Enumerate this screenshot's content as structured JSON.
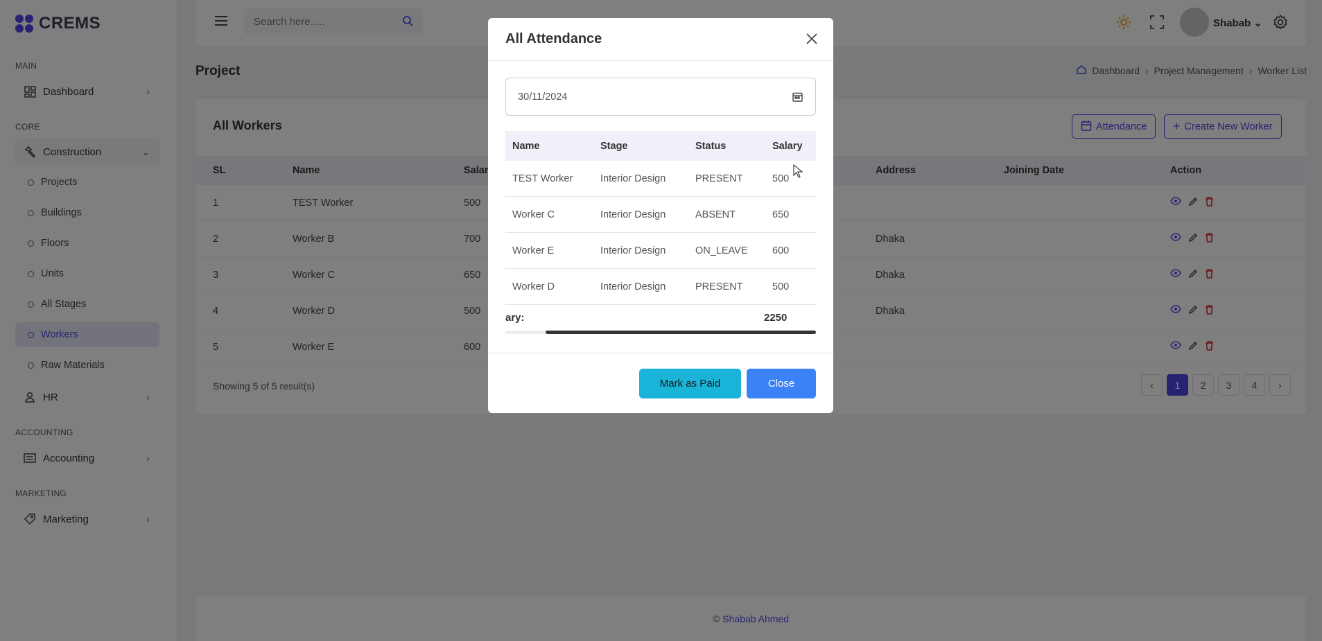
{
  "app": {
    "name": "CREMS"
  },
  "sidebar": {
    "sections": {
      "main": "MAIN",
      "core": "CORE",
      "accounting": "ACCOUNTING",
      "marketing": "MARKETING"
    },
    "items": {
      "dashboard": "Dashboard",
      "construction": "Construction",
      "hr": "HR",
      "accounting": "Accounting",
      "marketing": "Marketing"
    },
    "construction_sub": [
      "Projects",
      "Buildings",
      "Floors",
      "Units",
      "All Stages",
      "Workers",
      "Raw Materials"
    ],
    "active_sub": "Workers"
  },
  "topbar": {
    "search_placeholder": "Search here.....",
    "user_name": "Shabab"
  },
  "page": {
    "title": "Project",
    "breadcrumb": [
      "Dashboard",
      "Project Management",
      "Worker List"
    ]
  },
  "card": {
    "title": "All Workers",
    "attendance_button": "Attendance",
    "create_button": "Create New Worker",
    "columns": {
      "sl": "SL",
      "name": "Name",
      "salary": "Salar",
      "address": "Address",
      "joining": "Joining Date",
      "action": "Action"
    },
    "rows": [
      {
        "sl": "1",
        "name": "TEST Worker",
        "salary": "500",
        "address": "",
        "joining": ""
      },
      {
        "sl": "2",
        "name": "Worker B",
        "salary": "700",
        "address": "Dhaka",
        "joining": ""
      },
      {
        "sl": "3",
        "name": "Worker C",
        "salary": "650",
        "address": "Dhaka",
        "joining": ""
      },
      {
        "sl": "4",
        "name": "Worker D",
        "salary": "500",
        "address": "Dhaka",
        "joining": ""
      },
      {
        "sl": "5",
        "name": "Worker E",
        "salary": "600",
        "address": "",
        "joining": ""
      }
    ],
    "showing": "Showing 5 of 5 result(s)",
    "pages": [
      "1",
      "2",
      "3",
      "4"
    ],
    "current_page": "1"
  },
  "footer": {
    "copyright": "©",
    "author": "Shabab Ahmed"
  },
  "modal": {
    "title": "All Attendance",
    "date_value": "30/11/2024",
    "columns": {
      "name": "Name",
      "stage": "Stage",
      "status": "Status",
      "salary": "Salary"
    },
    "rows": [
      {
        "name": "TEST Worker",
        "stage": "Interior Design",
        "status": "PRESENT",
        "salary": "500"
      },
      {
        "name": "Worker C",
        "stage": "Interior Design",
        "status": "ABSENT",
        "salary": "650"
      },
      {
        "name": "Worker E",
        "stage": "Interior Design",
        "status": "ON_LEAVE",
        "salary": "600"
      },
      {
        "name": "Worker D",
        "stage": "Interior Design",
        "status": "PRESENT",
        "salary": "500"
      }
    ],
    "total_label": "ary:",
    "total_value": "2250",
    "mark_paid_button": "Mark as Paid",
    "close_button": "Close"
  },
  "colors": {
    "accent": "#4f46e5",
    "cyan": "#1ab4d9",
    "blue": "#3b82f6",
    "danger": "#dc2626"
  }
}
